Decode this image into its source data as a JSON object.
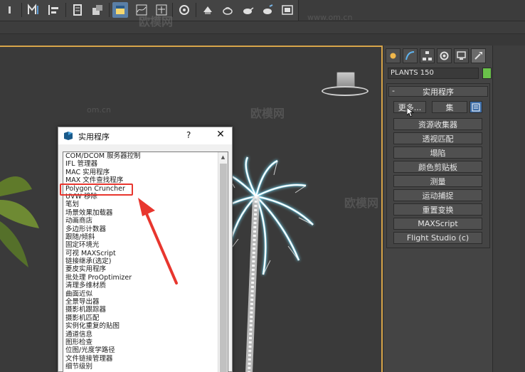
{
  "toolbar": {
    "buttons": [
      "select-and-link",
      "mirror",
      "align",
      "layer-explorer",
      "toggle-scene-explorer",
      "curve-editor",
      "schematic-view",
      "material-editor",
      "render-setup",
      "render-frame",
      "rendered-frame-window",
      "render-production",
      "render-iterative",
      "render-active"
    ]
  },
  "command_panel": {
    "tabs": [
      "create",
      "modify",
      "hierarchy",
      "motion",
      "display",
      "utilities"
    ],
    "object_name": "PLANTS 150",
    "color_swatch": "#6ac24a",
    "rollout_title": "实用程序",
    "rollout_toggle": "-",
    "more_label": "更多...",
    "sets_label": "集",
    "buttons": [
      "资源收集器",
      "透视匹配",
      "塌陷",
      "颜色剪贴板",
      "测量",
      "运动捕捉",
      "重置变换",
      "MAXScript",
      "Flight Studio (c)"
    ]
  },
  "dialog": {
    "title": "实用程序",
    "help": "?",
    "close": "✕",
    "items": [
      "COM/DCOM 服务器控制",
      "IFL 管理器",
      "MAC 实用程序",
      "MAX 文件查找程序",
      "Polygon Cruncher",
      "UVW 移除",
      "笔划",
      "场景效果加载器",
      "动画商店",
      "多边形计数器",
      "跟随/倾斜",
      "固定环境光",
      "可视 MAXScript",
      "链接继承(选定)",
      "菱皮实用程序",
      "批处理 ProOptimizer",
      "清理多维材质",
      "曲面近似",
      "全景导出器",
      "摄影机跟踪器",
      "摄影机匹配",
      "实例化重复的贴图",
      "通道信息",
      "图形检查",
      "位图/光度学路径",
      "文件链接管理器",
      "细节级别"
    ],
    "highlighted_item": "Polygon Cruncher"
  },
  "watermarks": {
    "brand": "欧模网",
    "domain": "www.om.cn",
    "short": "om.cn"
  },
  "colors": {
    "viewport_border": "#d8a54a",
    "highlight": "#e8362e",
    "active_button": "#5a7fa6"
  }
}
